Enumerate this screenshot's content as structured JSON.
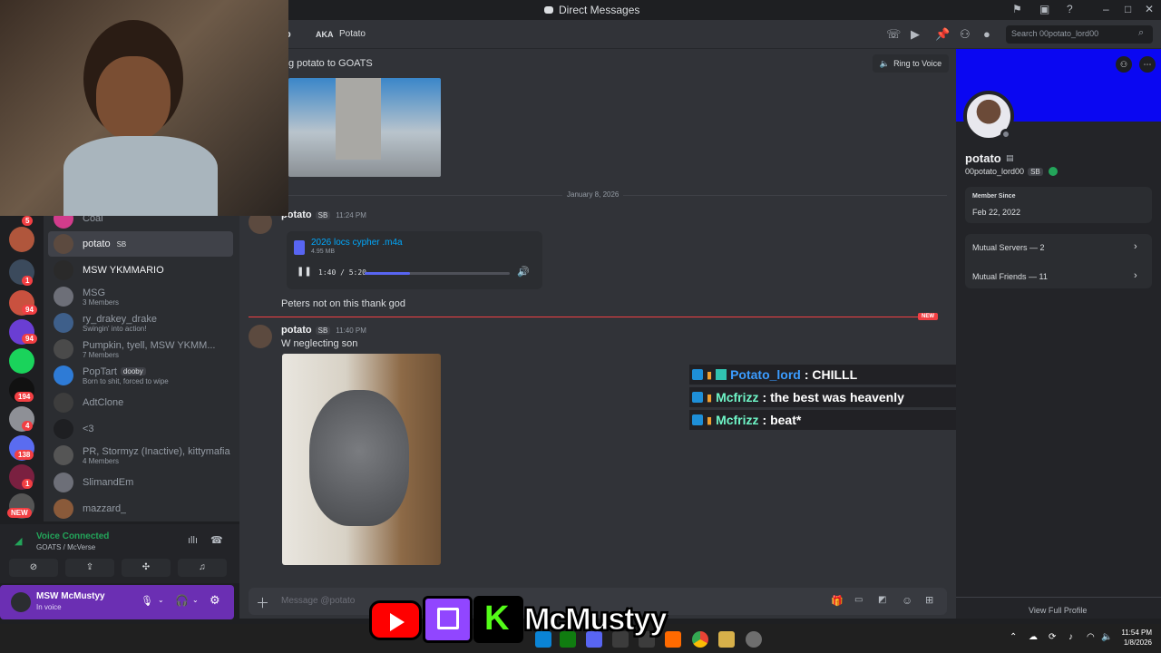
{
  "window": {
    "title": "Direct Messages"
  },
  "header": {
    "aka_label": "AKA",
    "aka_value": "Potato",
    "fragment": "o",
    "search_placeholder": "Search 00potato_lord00"
  },
  "chat": {
    "system_message": "g potato to GOATS",
    "ring_button": "Ring to Voice",
    "date_divider": "January 8, 2026",
    "new_badge": "NEW",
    "composer_placeholder": "Message @potato",
    "messages": [
      {
        "author": "potato",
        "tag": "SB",
        "time": "11:24 PM",
        "file": {
          "name": "2026 locs cypher .m4a",
          "size": "4.95 MB",
          "progress": "1:40 / 5:20"
        }
      },
      {
        "text": "Peters not on this thank god"
      },
      {
        "author": "potato",
        "tag": "SB",
        "time": "11:40 PM",
        "text": "W neglecting son"
      }
    ]
  },
  "stream_overlay": [
    {
      "user": "Potato_lord",
      "message": ": CHILLL",
      "color": "#3b9cff"
    },
    {
      "user": "Mcfrizz",
      "message": ": the best was heavenly",
      "color": "#6ff5c7"
    },
    {
      "user": "Mcfrizz",
      "message": ": beat*",
      "color": "#6ff5c7"
    }
  ],
  "audio_progress_fraction": 0.31,
  "dms": [
    {
      "name": "Coal",
      "sub": ""
    },
    {
      "name": "potato",
      "tag": "SB",
      "sub": ""
    },
    {
      "name": "MSW YKMMARIO",
      "sub": ""
    },
    {
      "name": "MSG",
      "sub": "3 Members"
    },
    {
      "name": "ry_drakey_drake",
      "sub": "Swingin' into action!"
    },
    {
      "name": "Pumpkin, tyell, MSW YKMM...",
      "sub": "7 Members"
    },
    {
      "name": "PopTart",
      "tag": "dooby",
      "sub": "Born to shit, forced to wipe"
    },
    {
      "name": "AdtClone",
      "sub": ""
    },
    {
      "name": "<3",
      "sub": ""
    },
    {
      "name": "PR, Stormyz (Inactive), kittymafia",
      "sub": "4 Members"
    },
    {
      "name": "SlimandEm",
      "sub": ""
    },
    {
      "name": "mazzard_",
      "sub": ""
    }
  ],
  "guild_badges": [
    "5",
    "1",
    "94",
    "94",
    "194",
    "4",
    "138",
    "1",
    "NEW"
  ],
  "voice": {
    "status": "Voice Connected",
    "channel": "GOATS / McVerse"
  },
  "user": {
    "name": "MSW McMustyy",
    "status": "In voice"
  },
  "profile": {
    "display_name": "potato",
    "username": "00potato_lord00",
    "tag": "SB",
    "member_since_label": "Member Since",
    "member_since": "Feb 22, 2022",
    "mutual_servers": "Mutual Servers — 2",
    "mutual_friends": "Mutual Friends — 11",
    "view_full": "View Full Profile"
  },
  "branding": {
    "channel_name": "McMustyy"
  },
  "taskbar": {
    "time": "11:54 PM",
    "date": "1/8/2026"
  },
  "colors": {
    "accent": "#5865f2",
    "banner": "#0a07f2",
    "new_line": "#f23f43",
    "user_panel": "#6b2fb3"
  }
}
